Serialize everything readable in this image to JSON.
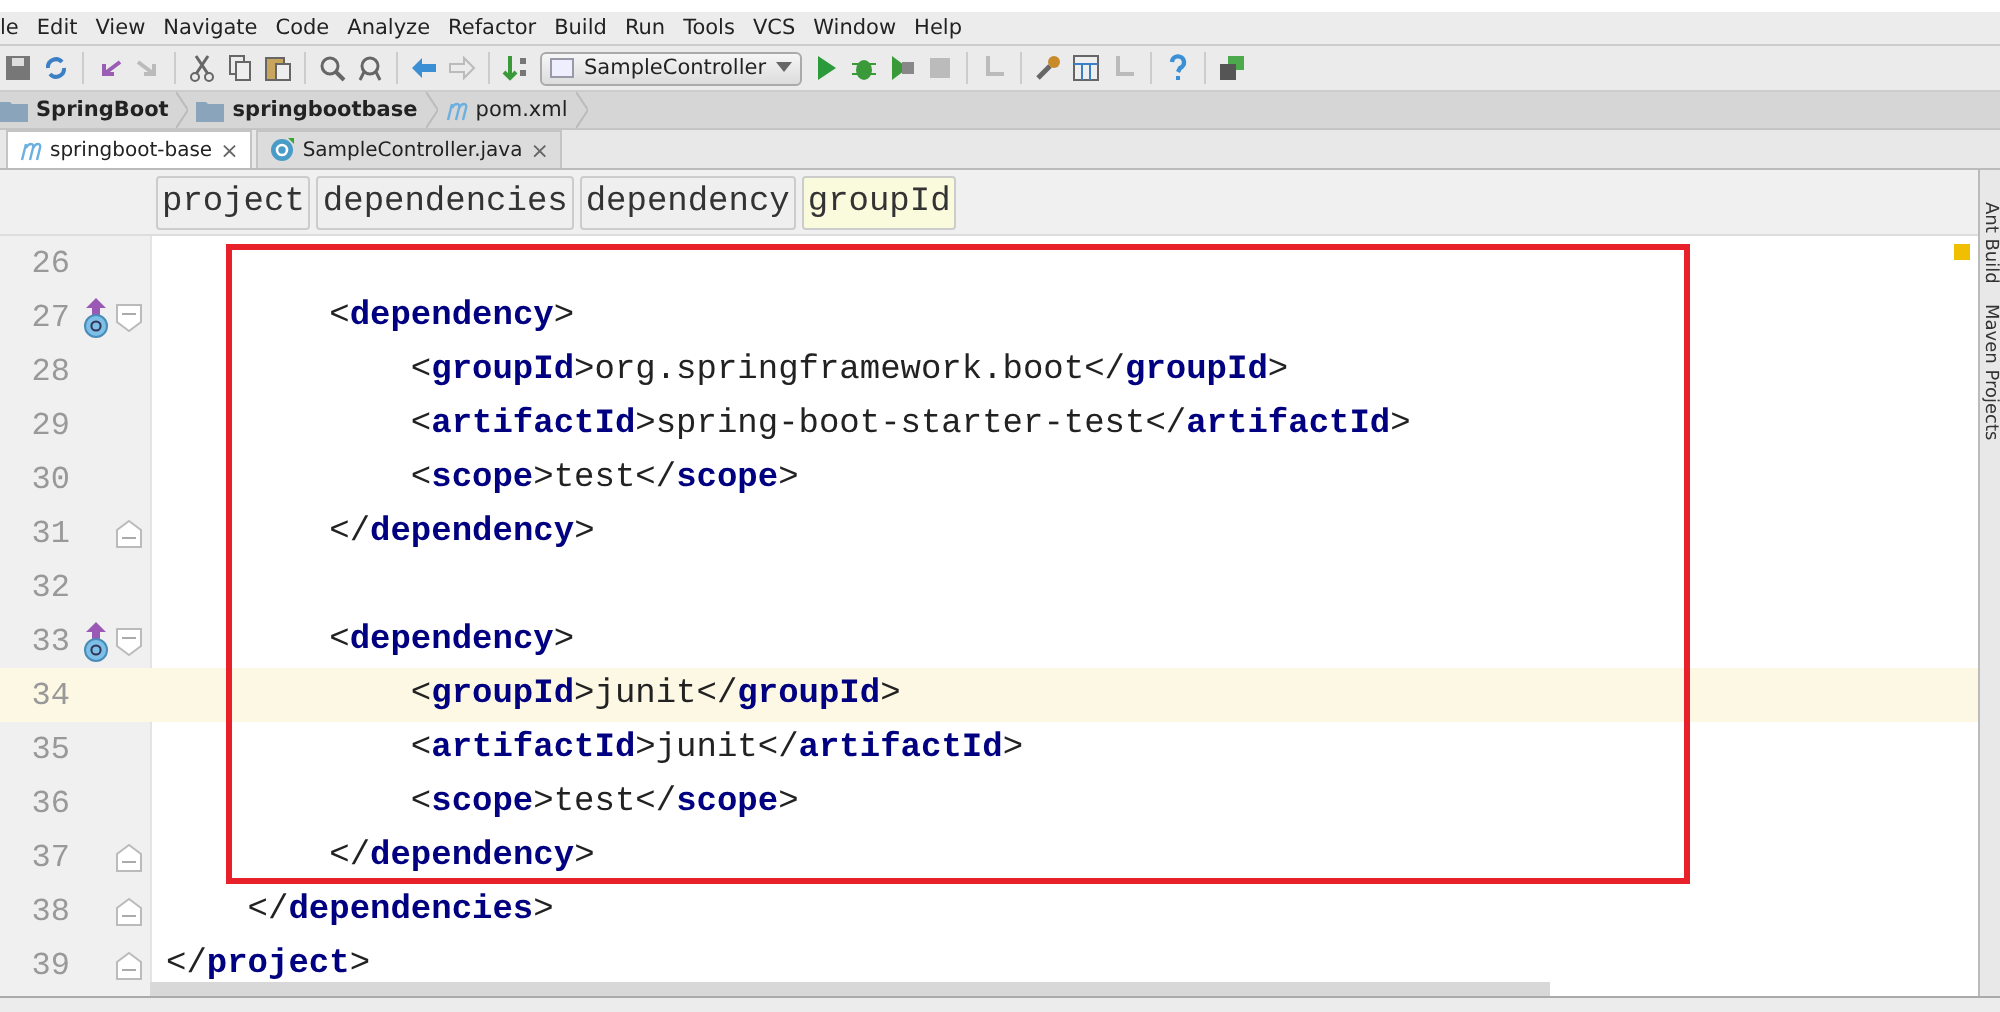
{
  "menu": [
    "le",
    "Edit",
    "View",
    "Navigate",
    "Code",
    "Analyze",
    "Refactor",
    "Build",
    "Run",
    "Tools",
    "VCS",
    "Window",
    "Help"
  ],
  "toolbar": {
    "run_config": "SampleController"
  },
  "navbar": [
    {
      "label": "SpringBoot",
      "kind": "folder"
    },
    {
      "label": "springbootbase",
      "kind": "folder"
    },
    {
      "label": "pom.xml",
      "kind": "maven"
    }
  ],
  "tabs": [
    {
      "label": "springboot-base",
      "kind": "maven",
      "selected": true,
      "close": "×"
    },
    {
      "label": "SampleController.java",
      "kind": "java",
      "selected": false,
      "close": "×"
    }
  ],
  "breadcrumb": [
    {
      "label": "project",
      "selected": false
    },
    {
      "label": "dependencies",
      "selected": false
    },
    {
      "label": "dependency",
      "selected": false
    },
    {
      "label": "groupId",
      "selected": true
    }
  ],
  "lines": [
    {
      "number": "26",
      "current": false,
      "override": false,
      "fold_start": false,
      "fold_end": false
    },
    {
      "number": "27",
      "text": "        <**dependency**>",
      "current": false,
      "override": true,
      "fold_start": true,
      "fold_end": false
    },
    {
      "number": "28",
      "text": "            <**groupId**>org.springframework.boot</**groupId**>",
      "current": false,
      "override": false,
      "fold_start": false,
      "fold_end": false
    },
    {
      "number": "29",
      "text": "            <**artifactId**>spring-boot-starter-test</**artifactId**>",
      "current": false,
      "override": false,
      "fold_start": false,
      "fold_end": false
    },
    {
      "number": "30",
      "text": "            <**scope**>test</**scope**>",
      "current": false,
      "override": false,
      "fold_start": false,
      "fold_end": false
    },
    {
      "number": "31",
      "text": "        </**dependency**>",
      "current": false,
      "override": false,
      "fold_start": false,
      "fold_end": true
    },
    {
      "number": "32",
      "current": false,
      "override": false,
      "fold_start": false,
      "fold_end": false
    },
    {
      "number": "33",
      "text": "        <**dependency**>",
      "current": false,
      "override": true,
      "fold_start": true,
      "fold_end": false
    },
    {
      "number": "34",
      "text": "            <**groupId**>junit</**groupId**>",
      "current": true,
      "override": false,
      "fold_start": false,
      "fold_end": false
    },
    {
      "number": "35",
      "text": "            <**artifactId**>junit</**artifactId**>",
      "current": false,
      "override": false,
      "fold_start": false,
      "fold_end": false
    },
    {
      "number": "36",
      "text": "            <**scope**>test</**scope**>",
      "current": false,
      "override": false,
      "fold_start": false,
      "fold_end": false
    },
    {
      "number": "37",
      "text": "        </**dependency**>",
      "current": false,
      "override": false,
      "fold_start": false,
      "fold_end": true
    },
    {
      "number": "38",
      "text": "    </**dependencies**>",
      "current": false,
      "override": false,
      "fold_start": false,
      "fold_end": true
    },
    {
      "number": "39",
      "text": "</**project**>",
      "current": false,
      "override": false,
      "fold_start": false,
      "fold_end": true
    }
  ],
  "side_tools": [
    "Ant Build",
    "Maven Projects"
  ]
}
